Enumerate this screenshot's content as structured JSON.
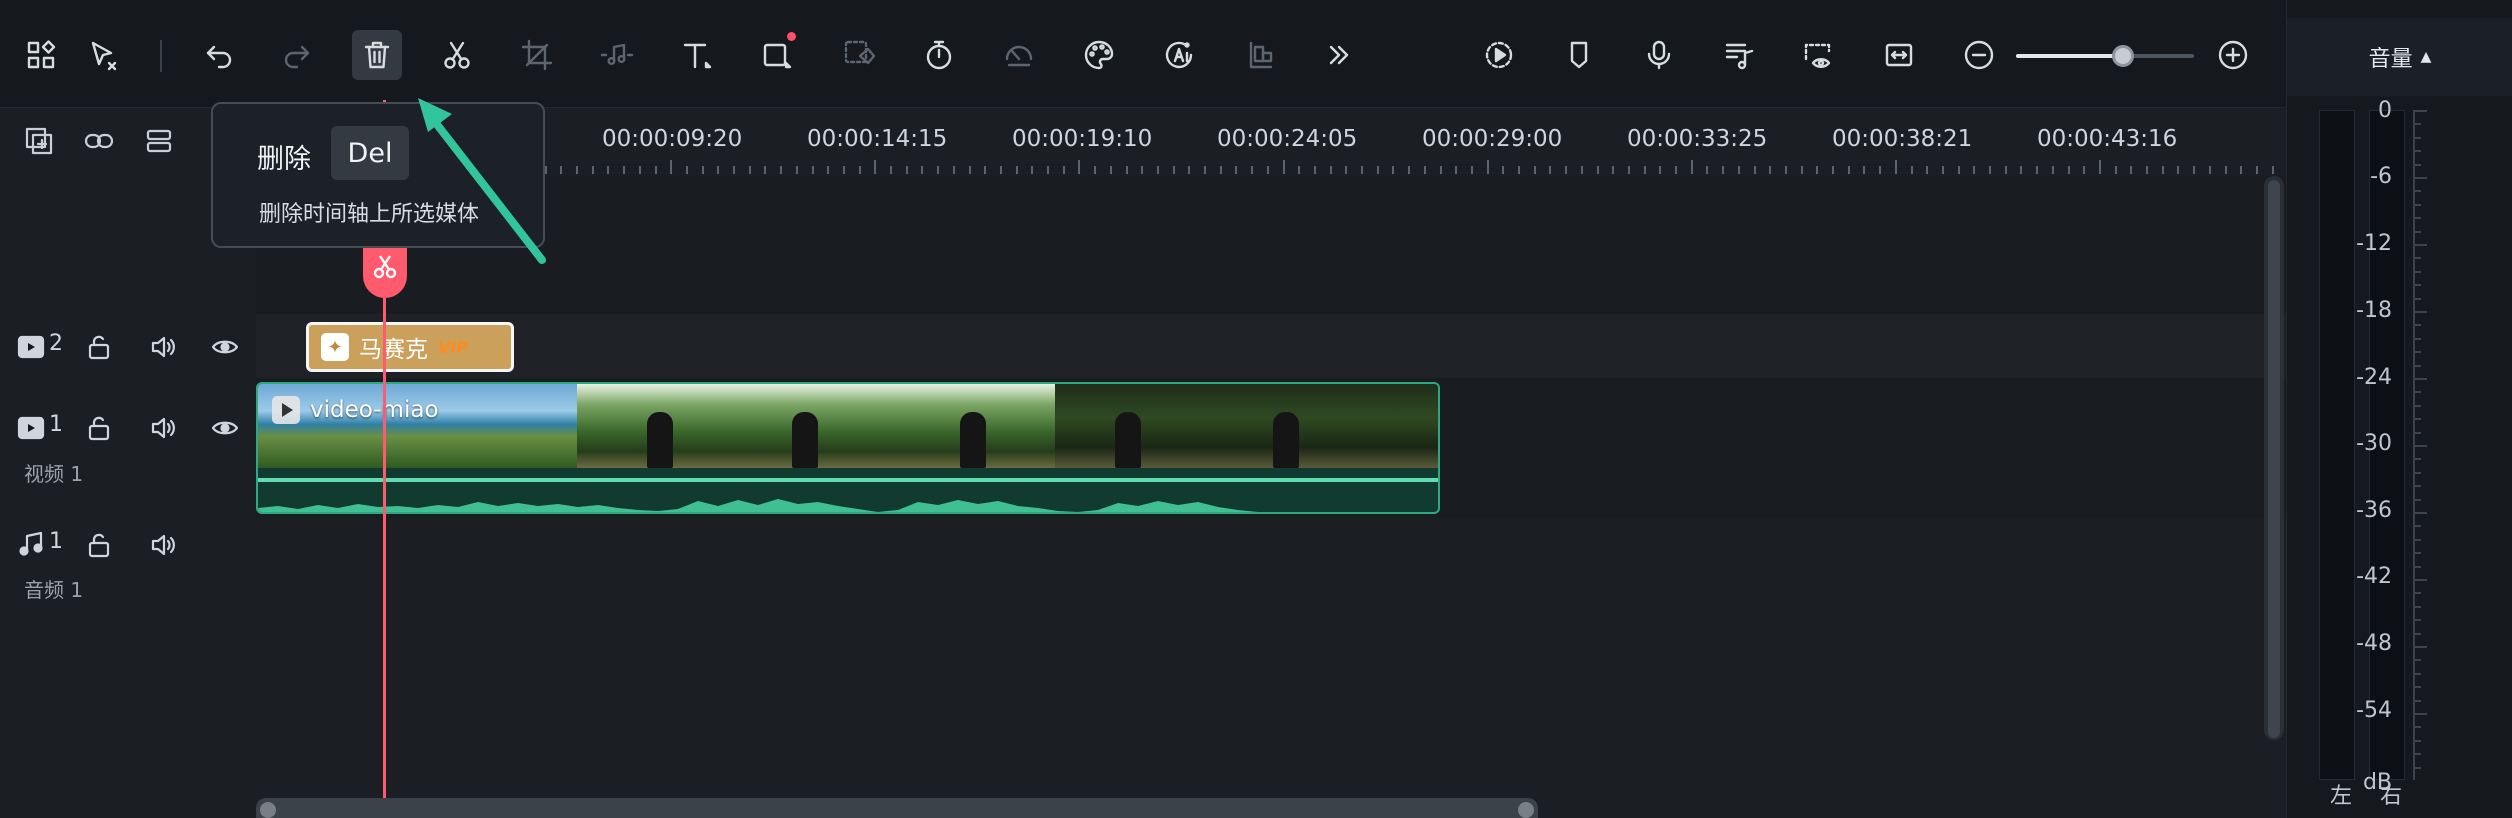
{
  "toolbar": {
    "buttons": [
      {
        "name": "layout-grid-icon",
        "state": "normal"
      },
      {
        "name": "select-arrow-icon",
        "state": "normal"
      },
      {
        "name": "undo-icon",
        "state": "normal"
      },
      {
        "name": "redo-icon",
        "state": "dim"
      },
      {
        "name": "delete-trash-icon",
        "state": "active"
      },
      {
        "name": "scissors-icon",
        "state": "normal"
      },
      {
        "name": "crop-icon",
        "state": "dim"
      },
      {
        "name": "audio-detach-icon",
        "state": "dim"
      },
      {
        "name": "text-icon",
        "state": "normal"
      },
      {
        "name": "shape-frame-icon",
        "state": "normal",
        "badge": true
      },
      {
        "name": "mask-shape-icon",
        "state": "dim"
      },
      {
        "name": "speed-timer-icon",
        "state": "normal"
      },
      {
        "name": "speed-ramp-icon",
        "state": "dim"
      },
      {
        "name": "color-palette-icon",
        "state": "normal"
      },
      {
        "name": "ai-audio-icon",
        "state": "normal"
      },
      {
        "name": "align-icon",
        "state": "dim"
      },
      {
        "name": "more-chevrons-icon",
        "state": "normal"
      },
      {
        "name": "render-preview-icon",
        "state": "normal"
      },
      {
        "name": "marker-icon",
        "state": "normal"
      },
      {
        "name": "microphone-icon",
        "state": "normal"
      },
      {
        "name": "music-list-icon",
        "state": "normal"
      },
      {
        "name": "preview-eye-icon",
        "state": "normal"
      },
      {
        "name": "fit-timeline-icon",
        "state": "normal"
      },
      {
        "name": "zoom-out-icon",
        "state": "normal"
      },
      {
        "name": "zoom-in-icon",
        "state": "normal"
      }
    ],
    "zoom_level": 0.6
  },
  "secondary_tools": [
    "add-track-icon",
    "link-icon",
    "group-icon"
  ],
  "ruler": {
    "labels": [
      "00:00:09:20",
      "00:00:14:15",
      "00:00:19:10",
      "00:00:24:05",
      "00:00:29:00",
      "00:00:33:25",
      "00:00:38:21",
      "00:00:43:16"
    ]
  },
  "tooltip": {
    "title": "删除",
    "shortcut": "Del",
    "description": "删除时间轴上所选媒体"
  },
  "tracks": {
    "effect": {
      "number": "2"
    },
    "video": {
      "number": "1",
      "name": "视频 1"
    },
    "audio": {
      "number": "1",
      "name": "音频 1"
    }
  },
  "clips": {
    "effect": {
      "label": "马赛克",
      "badge": "VIP"
    },
    "video": {
      "label": "video-miao"
    }
  },
  "volume_panel": {
    "title": "音量",
    "db_labels": [
      "0",
      "-6",
      "-12",
      "-18",
      "-24",
      "-30",
      "-36",
      "-42",
      "-48",
      "-54",
      "dB"
    ],
    "left_label": "左",
    "right_label": "右"
  },
  "colors": {
    "playhead": "#ff5a6e",
    "accent_green": "#2fa87f",
    "arrow": "#33c59a",
    "effect_clip": "#caa05a"
  }
}
